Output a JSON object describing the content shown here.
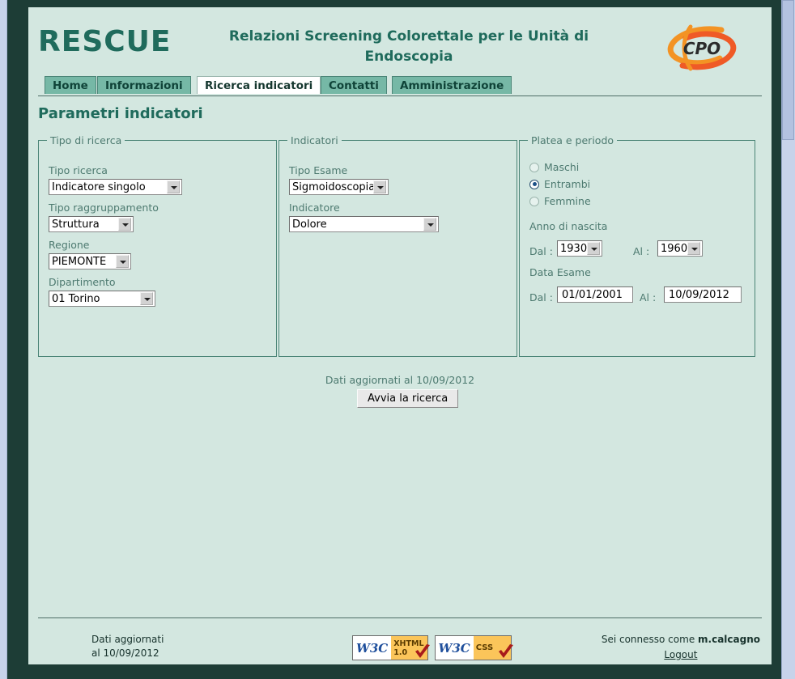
{
  "header": {
    "brand": "RESCUE",
    "site_title": "Relazioni Screening Colorettale per le Unità di Endoscopia",
    "logo_text": "CPO"
  },
  "tabs": [
    {
      "label": "Home",
      "active": false
    },
    {
      "label": "Informazioni",
      "active": false
    },
    {
      "label": "Ricerca indicatori",
      "active": true
    },
    {
      "label": "Contatti",
      "active": false
    },
    {
      "label": "Amministrazione",
      "active": false
    }
  ],
  "main": {
    "page_title": "Parametri indicatori",
    "updated_note": "Dati aggiornati al 10/09/2012",
    "submit_label": "Avvia la ricerca"
  },
  "fieldset_tipo_ricerca": {
    "legend": "Tipo di ricerca",
    "fields": [
      {
        "label": "Tipo ricerca",
        "value": "Indicatore singolo"
      },
      {
        "label": "Tipo raggruppamento",
        "value": "Struttura"
      },
      {
        "label": "Regione",
        "value": "PIEMONTE"
      },
      {
        "label": "Dipartimento",
        "value": "01 Torino"
      }
    ]
  },
  "fieldset_indicatori": {
    "legend": "Indicatori",
    "fields": [
      {
        "label": "Tipo Esame",
        "value": "Sigmoidoscopia"
      },
      {
        "label": "Indicatore",
        "value": "Dolore"
      }
    ]
  },
  "fieldset_platea": {
    "legend": "Platea e periodo",
    "gender_options": [
      {
        "label": "Maschi",
        "selected": false
      },
      {
        "label": "Entrambi",
        "selected": true
      },
      {
        "label": "Femmine",
        "selected": false
      }
    ],
    "anno_nascita_label": "Anno di nascita",
    "anno_dal_label": "Dal :",
    "anno_dal_value": "1930",
    "anno_al_label": "Al :",
    "anno_al_value": "1960",
    "data_esame_label": "Data Esame",
    "data_dal_label": "Dal :",
    "data_dal_value": "01/01/2001",
    "data_al_label": "Al :",
    "data_al_value": "10/09/2012"
  },
  "footer": {
    "updated_line1": "Dati aggiornati",
    "updated_line2": "al 10/09/2012",
    "connected_prefix": "Sei connesso come ",
    "connected_user": "m.calcagno",
    "logout_label": "Logout",
    "badge_xhtml_left": "W3C",
    "badge_xhtml_right_line1": "XHTML",
    "badge_xhtml_right_line2": "1.0",
    "badge_css_left": "W3C",
    "badge_css_right": "CSS"
  },
  "colors": {
    "frame_dark": "#1d3d36",
    "page_bg": "#d3e7e0",
    "brand_green": "#1f6b5c",
    "tab_green": "#76b8a6",
    "label_green": "#4d7a70"
  }
}
